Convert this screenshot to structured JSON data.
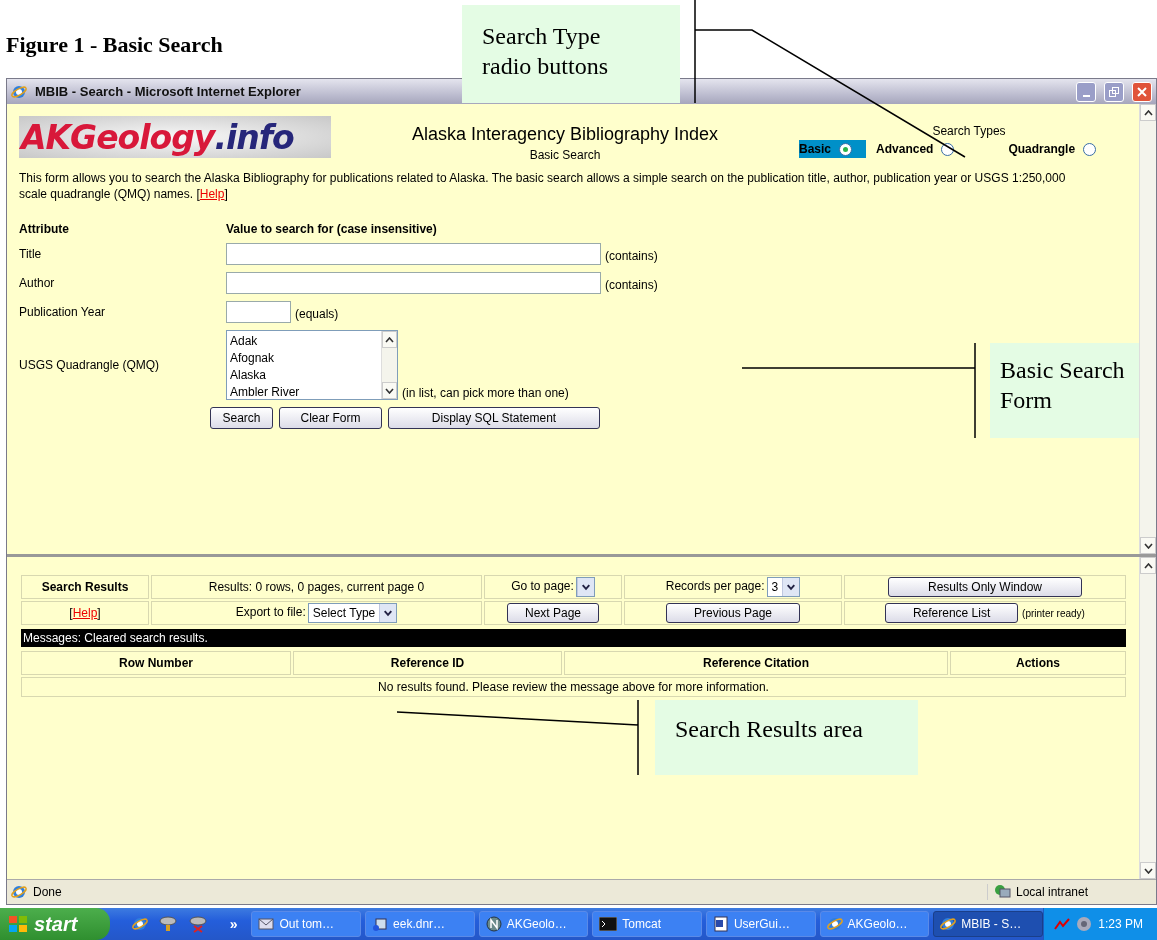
{
  "figure_title": "Figure 1 - Basic Search",
  "callouts": [
    {
      "text": "Search Type radio buttons"
    },
    {
      "text": "Basic Search Form"
    },
    {
      "text": "Search Results area"
    }
  ],
  "window": {
    "title": "MBIB - Search - Microsoft Internet Explorer"
  },
  "page": {
    "logo": [
      "AKGeology",
      ".info"
    ],
    "heading": "Alaska Interagency Bibliography Index",
    "subheading": "Basic Search",
    "search_types": {
      "label": "Search Types",
      "options": [
        {
          "label": "Basic",
          "selected": true
        },
        {
          "label": "Advanced",
          "selected": false
        },
        {
          "label": "Quadrangle",
          "selected": false
        }
      ]
    },
    "description": {
      "before": "This form allows you to search the Alaska Bibliography for publications related to Alaska. The basic search allows a simple search on the publication title, author, publication year or USGS 1:250,000 scale quadrangle (QMQ) names. [",
      "link": "Help",
      "after": "]"
    },
    "form": {
      "columns": [
        "Attribute",
        "Value to search for (case insensitive)"
      ],
      "fields": [
        {
          "kind": "text",
          "label": "Title",
          "note": "(contains)"
        },
        {
          "kind": "text",
          "label": "Author",
          "note": "(contains)"
        },
        {
          "kind": "year",
          "label": "Publication Year",
          "note": "(equals)"
        },
        {
          "kind": "list",
          "label": "USGS Quadrangle (QMQ)",
          "options": [
            "Adak",
            "Afognak",
            "Alaska",
            "Ambler River"
          ],
          "note": "(in list, can pick more than one)"
        }
      ],
      "buttons": [
        "Search",
        "Clear Form",
        "Display SQL Statement"
      ]
    }
  },
  "results": {
    "title": "Search Results",
    "summary": "Results: 0 rows, 0 pages, current page 0",
    "goto_label": "Go to page:",
    "per_page_label": "Records per page:",
    "per_page_value": "3",
    "results_only_button": "Results Only Window",
    "help": {
      "before": "[",
      "link": "Help",
      "after": "]"
    },
    "export_label": "Export to file:",
    "export_value": "Select Type",
    "next_button": "Next Page",
    "previous_button": "Previous Page",
    "reference_button": "Reference List",
    "reference_note": "(printer ready)",
    "message": "Messages: Cleared search results.",
    "columns": [
      "Row Number",
      "Reference ID",
      "Reference Citation",
      "Actions"
    ],
    "empty_message": "No results found. Please review the message above for more information."
  },
  "status_bar": {
    "text": "Done",
    "zone": "Local intranet"
  },
  "taskbar": {
    "start": "start",
    "overflow": "»",
    "tasks": [
      {
        "label": "Out tom…",
        "selected": false
      },
      {
        "label": "eek.dnr…",
        "selected": false
      },
      {
        "label": "AKGeolo…",
        "selected": false
      },
      {
        "label": "Tomcat",
        "selected": false
      },
      {
        "label": "UserGui…",
        "selected": false
      },
      {
        "label": "AKGeolo…",
        "selected": false
      },
      {
        "label": "MBIB - S…",
        "selected": true
      }
    ],
    "clock": "1:23 PM"
  }
}
